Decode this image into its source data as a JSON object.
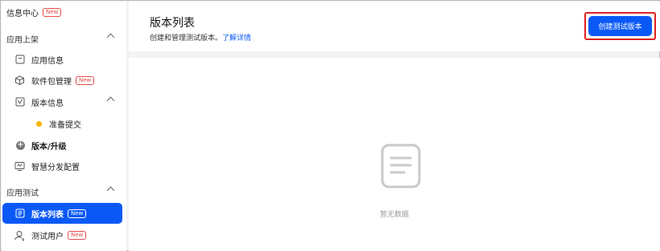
{
  "sidebar": {
    "info_center": {
      "label": "信息中心",
      "badge": "New"
    },
    "app_listing": {
      "label": "应用上架"
    },
    "items": [
      {
        "label": "应用信息",
        "icon": "app-info-icon"
      },
      {
        "label": "软件包管理",
        "icon": "package-icon",
        "badge": "New"
      },
      {
        "label": "版本信息",
        "icon": "version-info-icon"
      },
      {
        "label": "准备提交",
        "icon": "yellow-dot-icon"
      },
      {
        "label": "版本/升级",
        "icon": "plus-circle-icon"
      },
      {
        "label": "智慧分发配置",
        "icon": "smart-distribution-icon"
      }
    ],
    "app_testing": {
      "label": "应用测试"
    },
    "test_items": [
      {
        "label": "版本列表",
        "icon": "list-icon",
        "badge": "New",
        "active": true
      },
      {
        "label": "测试用户",
        "icon": "user-icon",
        "badge": "New"
      }
    ]
  },
  "header": {
    "title": "版本列表",
    "subtitle": "创建和管理测试版本。",
    "link": "了解详情",
    "create_button": "创建测试版本"
  },
  "content": {
    "empty_text": "暂无数据"
  },
  "colors": {
    "accent": "#0a59f7",
    "badge_red": "#e84d4d",
    "highlight_border": "#e02020",
    "status_yellow": "#f7b500"
  }
}
